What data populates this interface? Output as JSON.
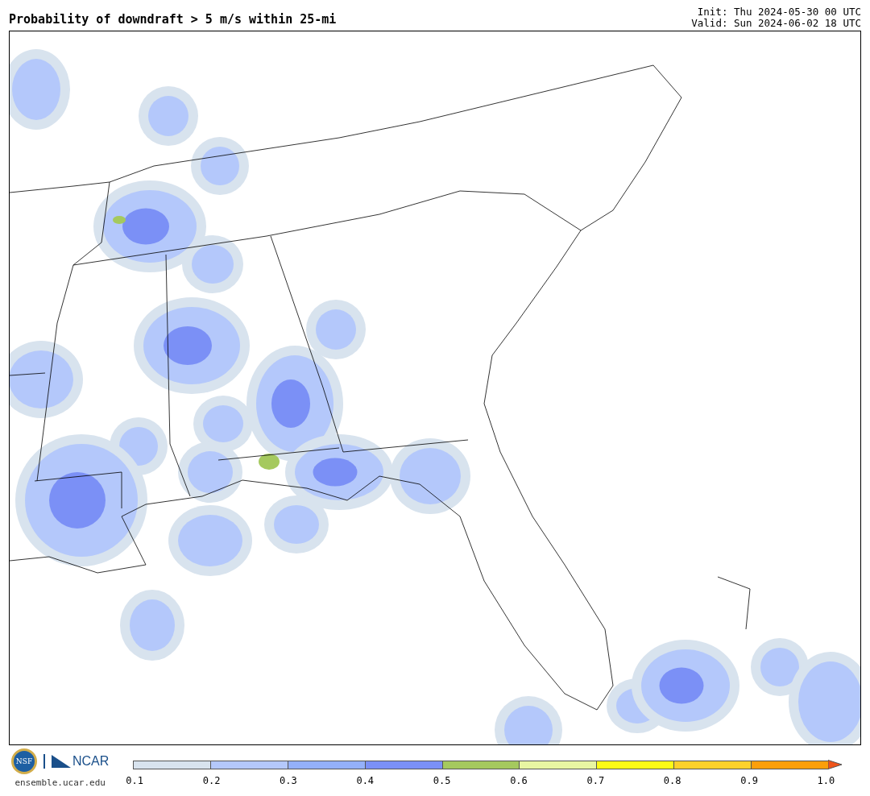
{
  "title": "Probability of downdraft > 5 m/s within 25-mi",
  "init": "Init: Thu 2024-05-30 00 UTC",
  "valid": "Valid: Sun 2024-06-02 18 UTC",
  "logos": {
    "nsf": "NSF",
    "ncar": "NCAR",
    "url": "ensemble.ucar.edu"
  },
  "colorbar": {
    "segments": [
      {
        "kind": "band",
        "color": "#d8e3ee"
      },
      {
        "kind": "band",
        "color": "#b4c8fb"
      },
      {
        "kind": "band",
        "color": "#94b0fa"
      },
      {
        "kind": "band",
        "color": "#7b90f6"
      },
      {
        "kind": "band",
        "color": "#a5c95e"
      },
      {
        "kind": "band",
        "color": "#e8f5a2"
      },
      {
        "kind": "band",
        "color": "#fdfb16"
      },
      {
        "kind": "band",
        "color": "#fdd12b"
      },
      {
        "kind": "band",
        "color": "#fc9f0a"
      },
      {
        "kind": "arrow",
        "color": "#f0541a"
      }
    ],
    "ticks": [
      "0.1",
      "0.2",
      "0.3",
      "0.4",
      "0.5",
      "0.6",
      "0.7",
      "0.8",
      "0.9",
      "1.0"
    ]
  }
}
